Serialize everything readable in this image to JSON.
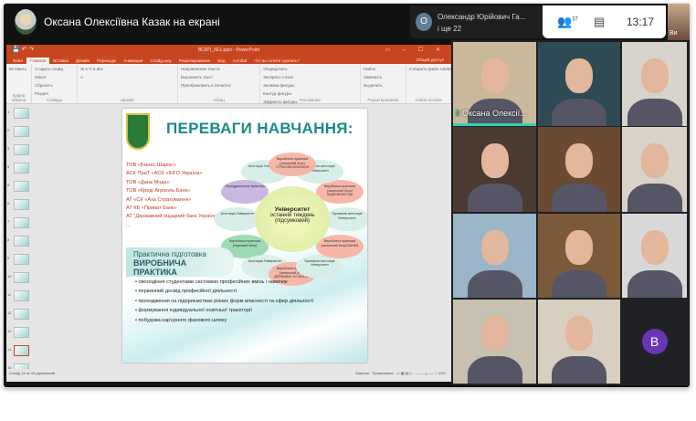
{
  "meet": {
    "presenter_title": "Оксана Олексіївна Казак на екрані",
    "speaker_name": "Олександр Юрійович Га...",
    "speaker_initial": "О",
    "speaker_more": "і ще 22",
    "participants_count": "37",
    "time": "13:17",
    "self_label": "Ви"
  },
  "ppt": {
    "window_title": "ВСЯП_ХЕ1.pptx - PowerPoint",
    "tabs": [
      "Файл",
      "Главная",
      "Вставка",
      "Дизайн",
      "Переходы",
      "Анимация",
      "Слайд-шоу",
      "Рецензирование",
      "Вид",
      "Acrobat",
      "Что вы хотите сделать?"
    ],
    "active_tab": 1,
    "share": "Общий доступ",
    "ribbon_groups": [
      {
        "label": "Буфер обмена",
        "items": [
          "Вставить"
        ]
      },
      {
        "label": "Слайды",
        "items": [
          "Создать слайд",
          "Макет",
          "Сбросить",
          "Раздел"
        ]
      },
      {
        "label": "Шрифт",
        "items": [
          "Ж К Ч S abc",
          "A"
        ]
      },
      {
        "label": "Абзац",
        "items": [
          "Направление текста",
          "Выровнять текст",
          "Преобразовать в SmartArt"
        ]
      },
      {
        "label": "Рисование",
        "items": [
          "Упорядочить",
          "Экспресс-стили",
          "Заливка фигуры",
          "Контур фигуры",
          "Эффекты фигуры"
        ]
      },
      {
        "label": "Редактирование",
        "items": [
          "Найти",
          "Заменить",
          "Выделить"
        ]
      },
      {
        "label": "Adobe Acrobat",
        "items": [
          "Створити файл Adobe PDF і надати до нього спільний доступ"
        ]
      }
    ],
    "slide_numbers": [
      "1",
      "2",
      "3",
      "4",
      "5",
      "6",
      "7",
      "8",
      "9",
      "10",
      "11",
      "12",
      "13",
      "14",
      "15"
    ],
    "selected_slide": "14",
    "status_left": "Слайд 14 из 15   украинский",
    "status_notes": "Заметки",
    "status_comments": "Примечания",
    "zoom": "49%"
  },
  "slide": {
    "title": "ПЕРЕВАГИ НАВЧАННЯ:",
    "partners": [
      "ТОВ «Бізнес Шарікс»",
      "АСК ПраТ «АСК «ІНГО Україна»",
      "ТОВ «Дана Мода»",
      "ТОВ «Креді Агріколь Банк»",
      "АТ «СК «Аха Страхування»",
      "АТ КБ «Приват Банк»",
      "АТ \"Державний ощадний банк України\"",
      "..."
    ],
    "center_title": "Університет",
    "center_sub": "останній тиждень (підсумковий)",
    "petals": [
      {
        "text": "Виробнича практика (загальний блок) СТРАХОВІ КОМПАНІЇ",
        "color": "#f6b7a8"
      },
      {
        "text": "Проміжна атестація Університет",
        "color": "#d8efe9"
      },
      {
        "text": "Виробнича практика (загальний блок) ПІДПРИЄМСТВА",
        "color": "#f6b7a8"
      },
      {
        "text": "Проміжна атестація Університет",
        "color": "#d8efe9"
      },
      {
        "text": "Виробнича практика (загальний блок) БАНКИ",
        "color": "#f6b7a8"
      },
      {
        "text": "Проміжна атестація Університет",
        "color": "#d8efe9"
      },
      {
        "text": "Виробнича практика (загальний блок) ДЕРЖАВНІ УСТАНОВИ",
        "color": "#f6b7a8"
      },
      {
        "text": "Атестація Університет",
        "color": "#d8efe9"
      },
      {
        "text": "Виробнича практика (науковий блок)",
        "color": "#9edbb5"
      },
      {
        "text": "Атестація Університет",
        "color": "#d8efe9"
      },
      {
        "text": "Переддипломна практика",
        "color": "#c9b7e3"
      },
      {
        "text": "Атестація Університет",
        "color": "#d8efe9"
      }
    ],
    "practice_title": "Практична підготовка",
    "practice_sub": "ВИРОБНИЧА ПРАКТИКА",
    "bullets": [
      "оволодіння студентами системою професійних вмінь і навичок",
      "первинний досвід професійної діяльності",
      "проходження на підприємствах різних форм власності та сфер діяльності",
      "формування індивідуальної освітньої траєкторії",
      "побудова кар'єрного фахового шляху"
    ]
  },
  "tiles": [
    {
      "label": "Оксана Олексії...",
      "speaking": true,
      "bg": "#c9b89a"
    },
    {
      "bg": "#2d4a55"
    },
    {
      "bg": "#d8d4cc"
    },
    {
      "bg": "#4a3a30"
    },
    {
      "bg": "#6a4a30"
    },
    {
      "bg": "#d9d2c8"
    },
    {
      "bg": "#9ab4c8"
    },
    {
      "bg": "#7a5a38"
    },
    {
      "bg": "#d8d8d8"
    },
    {
      "bg": "#c8c0b0"
    },
    {
      "bg": "#d8cfc0"
    },
    {
      "initial": "В",
      "bg": "#202124"
    }
  ],
  "colors": {
    "accent": "#c8461f",
    "meet_speaking": "#2ed3b7",
    "avatar_b": "#6a35b5"
  }
}
